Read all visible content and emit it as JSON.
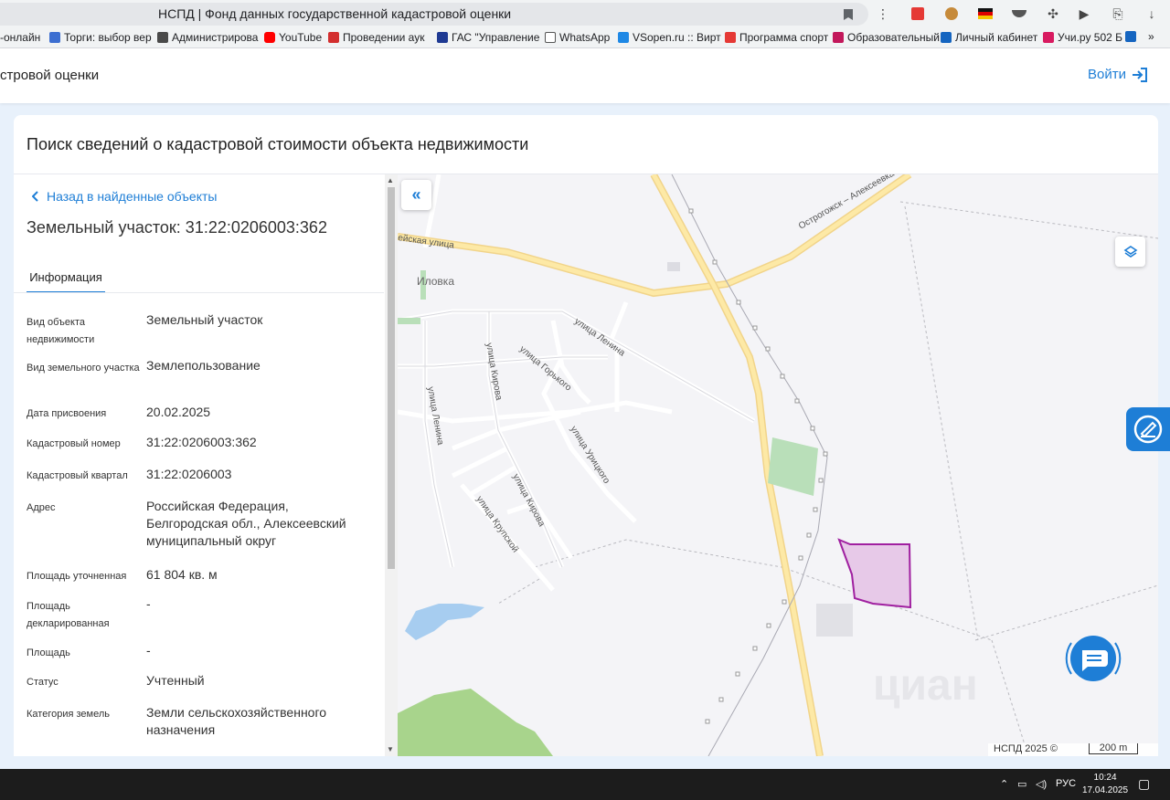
{
  "browser": {
    "tab_title": "НСПД | Фонд данных государственной кадастровой оценки",
    "bookmarks": [
      {
        "label": "-онлайн",
        "color": "#ffffff"
      },
      {
        "label": "Торги: выбор вер",
        "color": "#3d6fd1"
      },
      {
        "label": "Администрирова",
        "color": "#4a4a4a"
      },
      {
        "label": "YouTube",
        "color": "#ff0000"
      },
      {
        "label": "Проведении аук",
        "color": "#d32f2f"
      },
      {
        "label": "ГАС \"Управление",
        "color": "#1f3a93"
      },
      {
        "label": "WhatsApp",
        "color": "#ffffff"
      },
      {
        "label": "VSopen.ru :: Вирт",
        "color": "#1e88e5"
      },
      {
        "label": "Программа спорт",
        "color": "#e53935"
      },
      {
        "label": "Образовательный",
        "color": "#c2185b"
      },
      {
        "label": "Личный кабинет",
        "color": "#1565c0"
      },
      {
        "label": "Учи.ру 502 Б",
        "color": "#d81b60"
      }
    ]
  },
  "header": {
    "site_title": "стровой оценки",
    "login_label": "Войти"
  },
  "card": {
    "title": "Поиск сведений о кадастровой стоимости объекта недвижимости"
  },
  "panel": {
    "back_label": "Назад в найденные объекты",
    "object_title": "Земельный участок: 31:22:0206003:362",
    "tab_label": "Информация",
    "properties": [
      {
        "label": "Вид объекта недвижимости",
        "value": "Земельный участок"
      },
      {
        "label": "Вид земельного участка",
        "value": "Землепользование"
      },
      {
        "label": "Дата присвоения",
        "value": "20.02.2025"
      },
      {
        "label": "Кадастровый номер",
        "value": "31:22:0206003:362"
      },
      {
        "label": "Кадастровый квартал",
        "value": "31:22:0206003"
      },
      {
        "label": "Адрес",
        "value": "Российская Федерация, Белгородская обл., Алексеевский муниципальный округ"
      },
      {
        "label": "Площадь уточненная",
        "value": "61 804 кв. м"
      },
      {
        "label": "Площадь декларированная",
        "value": "-"
      },
      {
        "label": "Площадь",
        "value": "-"
      },
      {
        "label": "Статус",
        "value": "Учтенный"
      },
      {
        "label": "Категория земель",
        "value": "Земли сельскохозяйственного назначения"
      }
    ]
  },
  "map": {
    "labels": {
      "road_top": "Острогожск – Алексеевка",
      "street_left": "ейская улица",
      "village": "Иловка",
      "lenina1": "улица Ленина",
      "lenina2": "улица Ленина",
      "kirova1": "улица Кирова",
      "gorkogo": "улица Горького",
      "uritskogo": "улица Урицкого",
      "kirova2": "улица Кирова",
      "krupskoy": "улица Крупской"
    },
    "watermark": "циан",
    "copyright": "НСПД 2025 ©",
    "scale_label": "200 m",
    "parcel_color": "#a020a0"
  },
  "taskbar": {
    "lang": "РУС",
    "time": "10:24",
    "date": "17.04.2025"
  },
  "colors": {
    "accent": "#1e7ed6"
  }
}
